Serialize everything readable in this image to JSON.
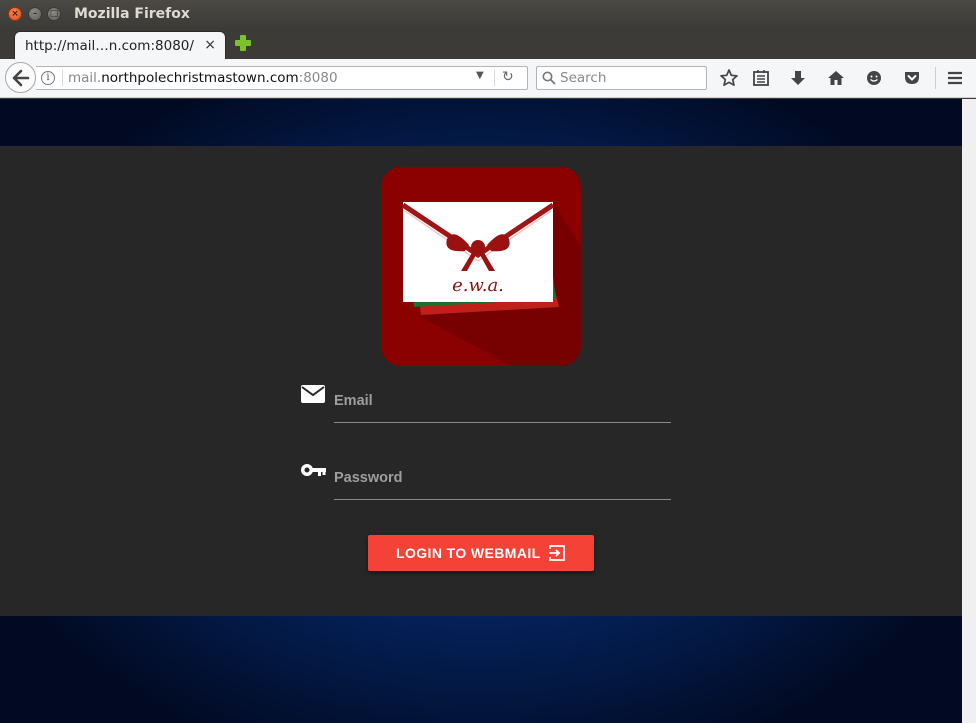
{
  "window": {
    "title": "Mozilla Firefox",
    "close_glyph": "×",
    "minimize_glyph": "–",
    "maximize_glyph": "□"
  },
  "tabs": [
    {
      "title": "http://mail…n.com:8080/",
      "close_glyph": "×",
      "active": true
    }
  ],
  "navbar": {
    "url_prefix": "mail.",
    "url_domain": "northpolechristmastown.com",
    "url_port": ":8080",
    "search_placeholder": "Search",
    "icons": [
      "back-icon",
      "info-icon",
      "dropdown-icon",
      "reload-icon",
      "search-icon",
      "bookmark-star-icon",
      "reading-list-icon",
      "download-icon",
      "home-icon",
      "hello-icon",
      "pocket-icon",
      "menu-icon"
    ]
  },
  "login": {
    "logo_text": "e.w.a.",
    "email_label": "Email",
    "password_label": "Password",
    "button_label": "LOGIN TO WEBMAIL",
    "icons": [
      "envelope-icon",
      "key-icon",
      "login-arrow-icon"
    ]
  },
  "colors": {
    "button": "#f44336",
    "card": "#272727",
    "background_blue": "#0a3a8a",
    "logo_red": "#8b0000",
    "envelope_green": "#1b6e2c"
  }
}
